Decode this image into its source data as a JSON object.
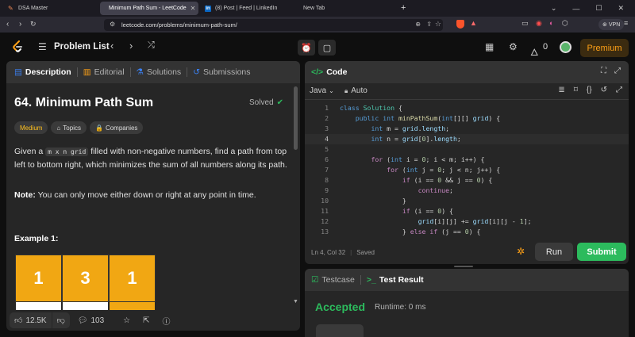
{
  "browser": {
    "tabs": [
      {
        "title": "DSA Master"
      },
      {
        "title": "Minimum Path Sum - LeetCode"
      },
      {
        "title": "(8) Post | Feed | LinkedIn"
      },
      {
        "title": "New Tab"
      }
    ],
    "url": "leetcode.com/problems/minimum-path-sum/",
    "vpn_label": "VPN"
  },
  "header": {
    "problem_list": "Problem List",
    "streak": "0",
    "premium": "Premium"
  },
  "left_tabs": [
    {
      "label": "Description"
    },
    {
      "label": "Editorial"
    },
    {
      "label": "Solutions"
    },
    {
      "label": "Submissions"
    }
  ],
  "problem": {
    "title": "64. Minimum Path Sum",
    "status": "Solved",
    "difficulty": "Medium",
    "topics": "Topics",
    "companies": "Companies",
    "desc_pre": "Given a ",
    "desc_code": "m x n grid",
    "desc_post": " filled with non-negative numbers, find a path from top left to bottom right, which minimizes the sum of all numbers along its path.",
    "note_label": "Note:",
    "note_text": " You can only move either down or right at any point in time.",
    "example_title": "Example 1:",
    "grid_row": [
      "1",
      "3",
      "1"
    ]
  },
  "footer": {
    "likes": "12.5K",
    "comments": "103"
  },
  "code_panel": {
    "title": "Code",
    "language": "Java",
    "auto": "Auto",
    "lines": [
      {
        "n": "1",
        "t": "class Solution {"
      },
      {
        "n": "2",
        "t": "    public int minPathSum(int[][] grid) {"
      },
      {
        "n": "3",
        "t": "        int m = grid.length;"
      },
      {
        "n": "4",
        "t": "        int n = grid[0].length;"
      },
      {
        "n": "5",
        "t": ""
      },
      {
        "n": "6",
        "t": "        for (int i = 0; i < m; i++) {"
      },
      {
        "n": "7",
        "t": "            for (int j = 0; j < n; j++) {"
      },
      {
        "n": "8",
        "t": "                if (i == 0 && j == 0) {"
      },
      {
        "n": "9",
        "t": "                    continue;"
      },
      {
        "n": "10",
        "t": "                }"
      },
      {
        "n": "11",
        "t": "                if (i == 0) {"
      },
      {
        "n": "12",
        "t": "                    grid[i][j] += grid[i][j - 1];"
      },
      {
        "n": "13",
        "t": "                } else if (j == 0) {"
      }
    ],
    "cursor": "Ln 4, Col 32",
    "saved": "Saved",
    "run": "Run",
    "submit": "Submit"
  },
  "result_panel": {
    "testcase": "Testcase",
    "test_result": "Test Result",
    "accepted": "Accepted",
    "runtime": "Runtime: 0 ms"
  },
  "colors": {
    "accent": "#ffa116",
    "accepted": "#2cbb5d",
    "submit": "#2cbb5d",
    "grid_cell": "#f1a713"
  }
}
